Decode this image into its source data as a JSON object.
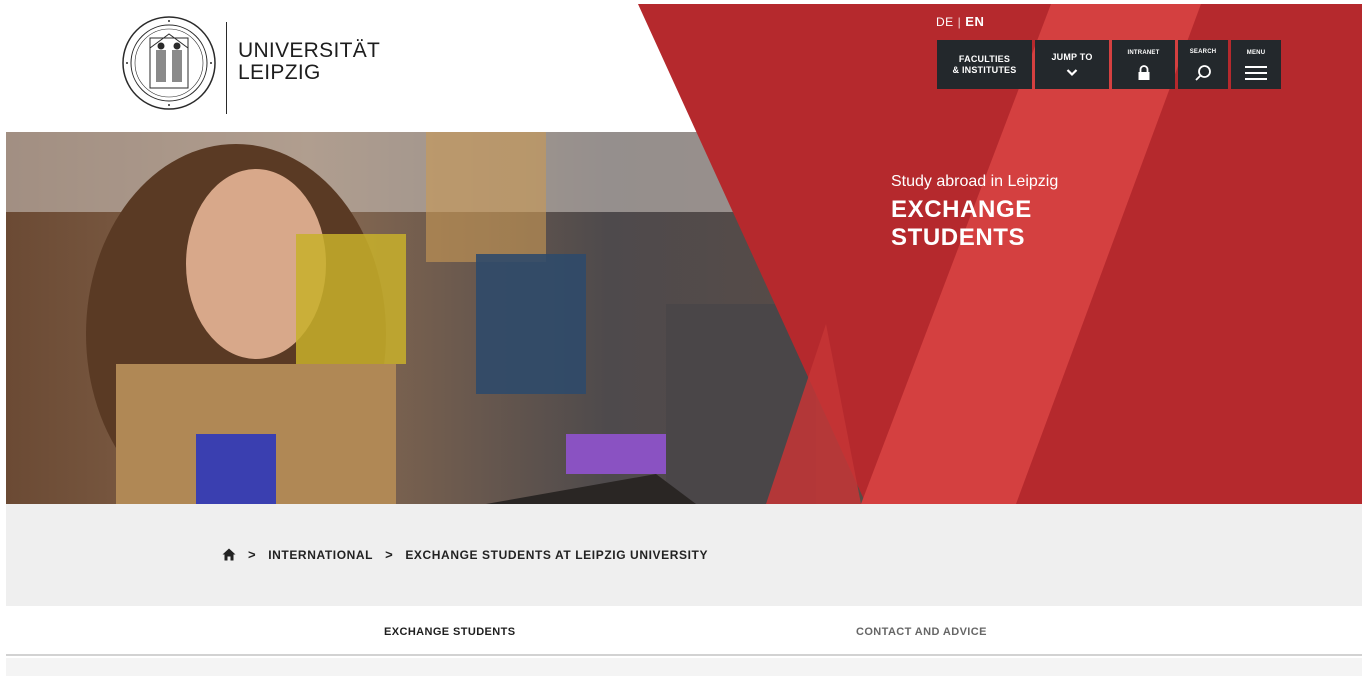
{
  "brand": {
    "name_line1": "UNIVERSITÄT",
    "name_line2": "LEIPZIG",
    "seal_text": "ALMA MATER LIPSIENSIS"
  },
  "language": {
    "inactive": "DE",
    "separator": "|",
    "active": "EN"
  },
  "topnav": {
    "faculties_label": "FACULTIES\n& INSTITUTES",
    "jump_label": "JUMP TO",
    "intranet_label": "INTRANET",
    "search_label": "SEARCH",
    "menu_label": "MENU"
  },
  "hero": {
    "subtitle": "Study abroad in Leipzig",
    "title": "EXCHANGE STUDENTS"
  },
  "breadcrumb": {
    "items": [
      "INTERNATIONAL",
      "EXCHANGE STUDENTS AT LEIPZIG UNIVERSITY"
    ],
    "separator": ">"
  },
  "tabs": [
    {
      "label": "EXCHANGE STUDENTS",
      "active": true
    },
    {
      "label": "CONTACT AND ADVICE",
      "active": false
    }
  ],
  "colors": {
    "brand_red": "#b5292d",
    "accent_red": "#d44040",
    "nav_dark": "#23282c",
    "breadcrumb_bg": "#efefef"
  }
}
